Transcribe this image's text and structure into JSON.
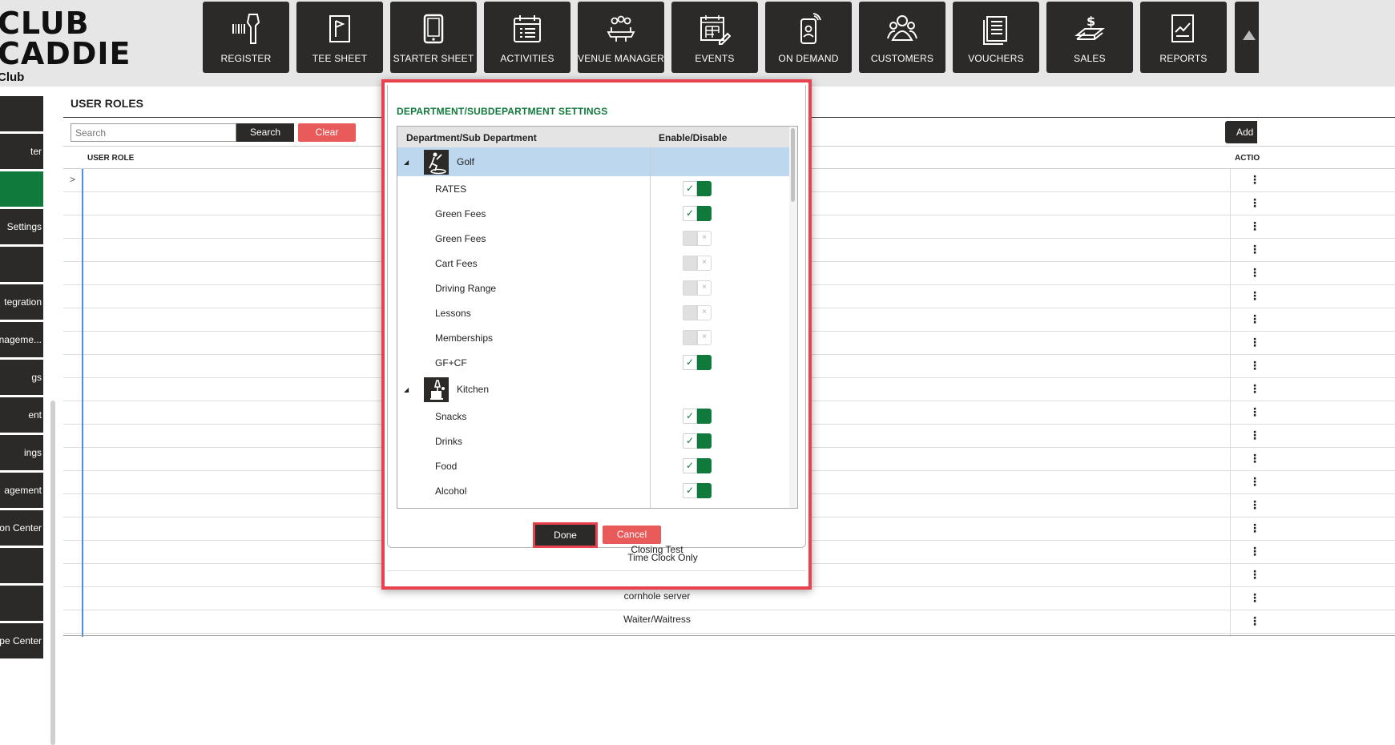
{
  "brand": {
    "line1": "CLUB",
    "line2": "CADDIE",
    "line3": "Club"
  },
  "nav": [
    {
      "label": "REGISTER",
      "icon": "barcode-scanner-icon"
    },
    {
      "label": "TEE SHEET",
      "icon": "flag-sheet-icon"
    },
    {
      "label": "STARTER SHEET",
      "icon": "tablet-icon"
    },
    {
      "label": "ACTIVITIES",
      "icon": "calendar-list-icon"
    },
    {
      "label": "VENUE MANAGER",
      "icon": "meeting-table-icon"
    },
    {
      "label": "EVENTS",
      "icon": "calendar-edit-icon"
    },
    {
      "label": "ON DEMAND",
      "icon": "mobile-icon"
    },
    {
      "label": "CUSTOMERS",
      "icon": "people-icon"
    },
    {
      "label": "VOUCHERS",
      "icon": "voucher-icon"
    },
    {
      "label": "SALES",
      "icon": "cash-icon"
    },
    {
      "label": "REPORTS",
      "icon": "report-icon"
    }
  ],
  "sidebar": {
    "items": [
      {
        "label": ""
      },
      {
        "label": "ter"
      },
      {
        "label": ""
      },
      {
        "label": "Settings"
      },
      {
        "label": ""
      },
      {
        "label": "tegration"
      },
      {
        "label": "anageme..."
      },
      {
        "label": "gs"
      },
      {
        "label": "ent"
      },
      {
        "label": "ings"
      },
      {
        "label": "agement"
      },
      {
        "label": "on Center"
      },
      {
        "label": ""
      },
      {
        "label": ""
      },
      {
        "label": "pe Center"
      }
    ],
    "active_index": 2
  },
  "main": {
    "title": "USER ROLES",
    "search_placeholder": "Search",
    "search_button": "Search",
    "clear_button": "Clear",
    "add_button": "Add",
    "col_user_role": "USER ROLE",
    "col_action": "ACTIO",
    "expand_glyph": ">",
    "menu_glyph": "⋮",
    "visible_roles": [
      "Closing Test",
      "Time Clock Only",
      "cornhole server",
      "Waiter/Waitress"
    ]
  },
  "modal": {
    "title": "DEPARTMENT/SUBDEPARTMENT SETTINGS",
    "col_dept": "Department/Sub Department",
    "col_enable": "Enable/Disable",
    "groups": [
      {
        "name": "Golf",
        "icon": "golfer-icon",
        "selected": true,
        "items": [
          {
            "name": "RATES",
            "enabled": true
          },
          {
            "name": "Green Fees",
            "enabled": true
          },
          {
            "name": "Green Fees",
            "enabled": false
          },
          {
            "name": "Cart Fees",
            "enabled": false
          },
          {
            "name": "Driving Range",
            "enabled": false
          },
          {
            "name": "Lessons",
            "enabled": false
          },
          {
            "name": "Memberships",
            "enabled": false
          },
          {
            "name": "GF+CF",
            "enabled": true
          }
        ]
      },
      {
        "name": "Kitchen",
        "icon": "food-drink-icon",
        "selected": false,
        "items": [
          {
            "name": "Snacks",
            "enabled": true
          },
          {
            "name": "Drinks",
            "enabled": true
          },
          {
            "name": "Food",
            "enabled": true
          },
          {
            "name": "Alcohol",
            "enabled": true
          }
        ]
      }
    ],
    "done_button": "Done",
    "cancel_button": "Cancel"
  },
  "colors": {
    "accent_green": "#0f7a3c",
    "dark": "#2b2a29",
    "danger": "#e95b5b",
    "highlight_border": "#e9424f",
    "row_selected": "#bcd7ee"
  }
}
